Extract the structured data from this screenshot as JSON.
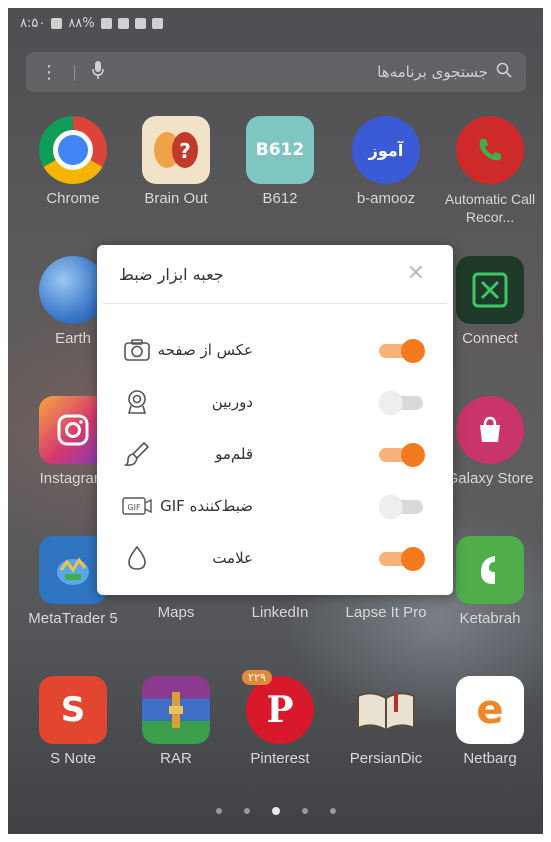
{
  "status_bar": {
    "time": "۸:۵۰",
    "battery": "۸۸%"
  },
  "search": {
    "placeholder": "جستجوی برنامه‌ها"
  },
  "apps": {
    "row1": [
      {
        "label": "Chrome",
        "color": "#ffffff"
      },
      {
        "label": "Brain Out",
        "color": "#f2e3c8"
      },
      {
        "label": "B612",
        "color": "#7fc6c2",
        "icon_text": "B612"
      },
      {
        "label": "b-amooz",
        "color": "#3b5bd6",
        "icon_text": "آموز"
      },
      {
        "label": "Automatic Call Recor...",
        "color": "#cf2a2a"
      }
    ],
    "row2": [
      {
        "label": "Earth",
        "color": "#4f8fd8"
      },
      {
        "label": "Connect",
        "color": "#2f6b43"
      }
    ],
    "row3": [
      {
        "label": "Instagram",
        "color": "#d6386d"
      },
      {
        "label": "Galaxy Store",
        "color": "#c9346a"
      }
    ],
    "row4": [
      {
        "label": "MetaTrader 5",
        "color": "#3a8ad6"
      },
      {
        "label": "Maps",
        "color": ""
      },
      {
        "label": "LinkedIn",
        "color": ""
      },
      {
        "label": "Lapse It Pro",
        "color": ""
      },
      {
        "label": "Ketabrah",
        "color": "#4fae4a"
      }
    ],
    "row5": [
      {
        "label": "S Note",
        "color": "#e2462f",
        "icon_text": "S"
      },
      {
        "label": "RAR",
        "color": "#8a3b8f"
      },
      {
        "label": "Pinterest",
        "color": "#d7192b",
        "icon_text": "P",
        "badge": "۲۲۹"
      },
      {
        "label": "PersianDic",
        "color": "#9a2f2f"
      },
      {
        "label": "Netbarg",
        "color": "#ffffff",
        "icon_text": "e"
      }
    ]
  },
  "dialog": {
    "title": "جعبه ابزار ضبط",
    "close_icon": "close-icon",
    "options": [
      {
        "label": "عکس از صفحه",
        "icon": "camera-icon",
        "enabled": true
      },
      {
        "label": "دوربین",
        "icon": "webcam-icon",
        "enabled": false
      },
      {
        "label": "قلم‌مو",
        "icon": "brush-icon",
        "enabled": true
      },
      {
        "label": "ضبط‌کننده GIF",
        "icon": "gif-icon",
        "icon_text": "GIF",
        "enabled": false
      },
      {
        "label": "علامت",
        "icon": "watermark-drop-icon",
        "enabled": true
      }
    ],
    "accent_color": "#f47a20"
  },
  "pager": {
    "count": 5,
    "active": 2
  }
}
